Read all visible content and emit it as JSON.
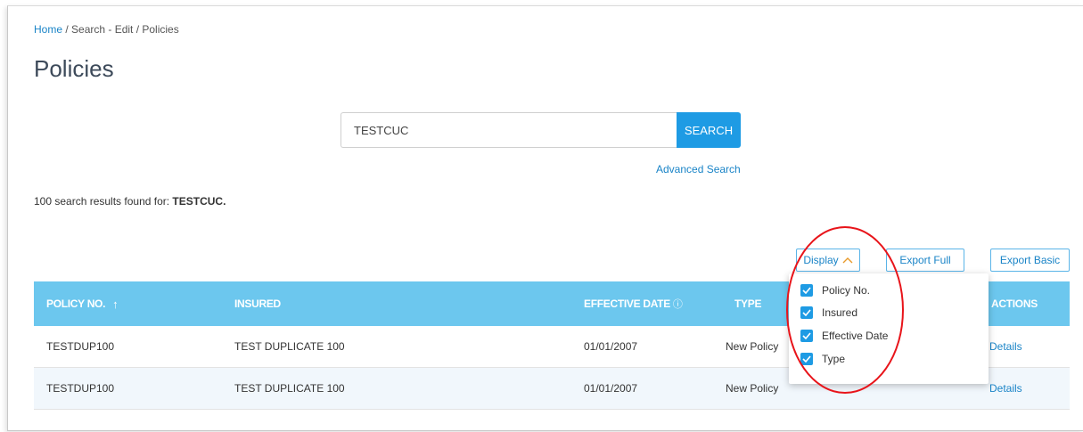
{
  "breadcrumb": {
    "home": "Home",
    "rest": " / Search - Edit / Policies"
  },
  "page_title": "Policies",
  "search": {
    "value": "TESTCUC",
    "button_label": "SEARCH",
    "advanced_label": "Advanced Search"
  },
  "results": {
    "prefix": "100 search results found for: ",
    "term": "TESTCUC."
  },
  "toolbar": {
    "display_label": "Display",
    "display_chevron": "^",
    "export_full": "Export Full",
    "export_basic": "Export Basic"
  },
  "table": {
    "headers": {
      "policy_no": "POLICY NO.",
      "sort_arrow": "↑",
      "insured": "INSURED",
      "effective_date": "EFFECTIVE DATE",
      "info_glyph": "ⓘ",
      "type": "TYPE",
      "actions": "ACTIONS"
    },
    "rows": [
      {
        "policy_no": "TESTDUP100",
        "insured": "TEST DUPLICATE 100",
        "effective_date": "01/01/2007",
        "type": "New Policy",
        "action": "Details"
      },
      {
        "policy_no": "TESTDUP100",
        "insured": "TEST DUPLICATE 100",
        "effective_date": "01/01/2007",
        "type": "New Policy",
        "action": "Details"
      }
    ]
  },
  "display_menu": {
    "options": [
      {
        "label": "Policy No.",
        "checked": true
      },
      {
        "label": "Insured",
        "checked": true
      },
      {
        "label": "Effective Date",
        "checked": true
      },
      {
        "label": "Type",
        "checked": true
      }
    ]
  },
  "colors": {
    "accent": "#1e9be4",
    "table_header": "#6cc7ee",
    "link": "#1a84c7",
    "annotation_circle": "#e8141a",
    "chevron": "#e89a2b"
  }
}
